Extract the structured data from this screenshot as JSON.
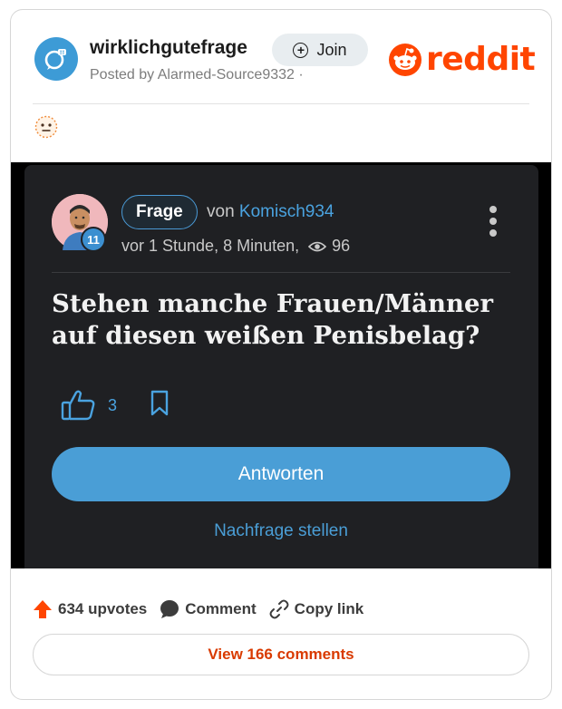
{
  "header": {
    "subreddit": "wirklichgutefrage",
    "posted_by": "Posted by Alarmed-Source9332 ·",
    "join_label": "Join",
    "logo_text": "reddit"
  },
  "post": {
    "tag": "Frage",
    "von_label": "von",
    "author": "Komisch934",
    "level": "11",
    "time": "vor 1 Stunde, 8 Minuten,",
    "views": "96",
    "title": "Stehen manche Frauen/Männer auf diesen weißen Penisbelag?",
    "likes": "3",
    "answer_label": "Antworten",
    "nachfrage_label": "Nachfrage stellen"
  },
  "footer": {
    "upvotes": "634 upvotes",
    "comment_label": "Comment",
    "copy_link_label": "Copy link",
    "view_comments_label": "View 166 comments"
  },
  "colors": {
    "reddit_orange": "#ff4500",
    "accent_blue": "#4a9ed6",
    "panel_dark": "#1f2023"
  }
}
